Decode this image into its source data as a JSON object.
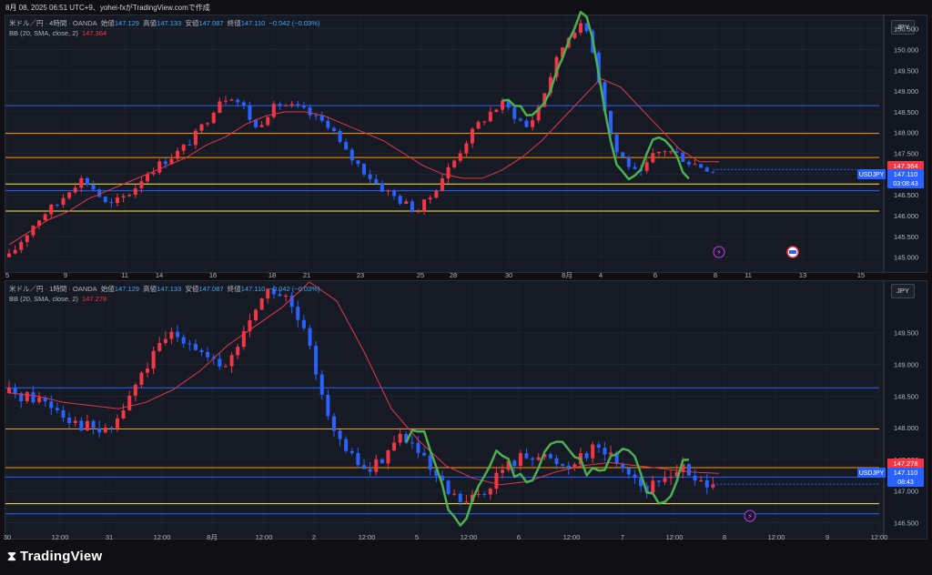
{
  "header": {
    "timestamp_line": "8月 08, 2025 06:51 UTC+9、yohei-fxがTradingView.comで作成"
  },
  "colors": {
    "up": "#f23645",
    "down": "#2962ff",
    "bb": "#e0384a",
    "green_curve": "#4caf50",
    "orange_line": "#ff9800",
    "yellow_line": "#ffeb3b",
    "blue_line": "#2962ff"
  },
  "branding": {
    "logo_text": "TradingView",
    "logo_icon": "tradingview-logo-icon"
  },
  "panels": [
    {
      "legend": {
        "symbol": "米ドル／円 · 4時間 · OANDA",
        "o_label": "始値",
        "o": "147.129",
        "h_label": "高値",
        "h": "147.133",
        "l_label": "安値",
        "l": "147.087",
        "c_label": "終値",
        "c": "147.110",
        "chg": "−0.042 (−0.03%)",
        "bb_label": "BB (20, SMA, close, 2)",
        "bb_value": "147.364"
      },
      "currency": "JPY",
      "price_tag": {
        "symbol": "USDJPY",
        "price": "147.110",
        "countdown": "03:08:43",
        "bb_tag": "147.364"
      },
      "chart_data": {
        "type": "candlestick",
        "timeframe": "4時間",
        "ylim": [
          144.75,
          150.8
        ],
        "y_ticks": [
          "150.500",
          "150.000",
          "149.500",
          "149.000",
          "148.500",
          "148.000",
          "147.500",
          "147.000",
          "146.500",
          "146.000",
          "145.500",
          "145.000"
        ],
        "x_ticks": [
          "5",
          "9",
          "11",
          "14",
          "16",
          "18",
          "21",
          "23",
          "25",
          "28",
          "30",
          "8月",
          "4",
          "6",
          "8",
          "11",
          "13",
          "15"
        ],
        "close_path": [
          145.0,
          145.4,
          145.8,
          146.1,
          146.3,
          146.7,
          146.9,
          146.6,
          146.2,
          146.4,
          146.6,
          147.0,
          147.2,
          147.4,
          147.6,
          147.9,
          148.3,
          148.8,
          148.9,
          148.6,
          148.1,
          148.5,
          148.7,
          148.6,
          148.5,
          148.3,
          148.2,
          147.6,
          147.3,
          147.0,
          146.7,
          146.5,
          146.3,
          146.1,
          146.4,
          146.9,
          147.3,
          147.8,
          148.2,
          148.5,
          148.7,
          148.4,
          148.1,
          148.7,
          149.5,
          150.2,
          150.6,
          150.4,
          148.9,
          147.6,
          147.3,
          146.9,
          147.4,
          147.6,
          147.5,
          147.3,
          147.2,
          147.1
        ],
        "bb_midline": [
          145.3,
          145.6,
          145.9,
          146.1,
          146.4,
          146.6,
          146.8,
          147.0,
          147.2,
          147.4,
          147.7,
          147.9,
          148.2,
          148.4,
          148.5,
          148.5,
          148.4,
          148.2,
          148.0,
          147.8,
          147.5,
          147.2,
          147.0,
          146.9,
          146.9,
          147.1,
          147.4,
          147.8,
          148.3,
          148.8,
          149.3,
          149.1,
          148.6,
          148.1,
          147.6,
          147.3,
          147.3
        ],
        "horizontal_lines": [
          {
            "price": 148.65,
            "color": "blue"
          },
          {
            "price": 147.98,
            "color": "orange"
          },
          {
            "price": 147.4,
            "color": "orange"
          },
          {
            "price": 146.76,
            "color": "yellow"
          },
          {
            "price": 146.6,
            "color": "blue"
          },
          {
            "price": 146.11,
            "color": "yellow"
          }
        ],
        "marker_icons": [
          "lightning-event-icon",
          "us-flag-event-icon"
        ]
      }
    },
    {
      "legend": {
        "symbol": "米ドル／円 · 1時間 · OANDA",
        "o_label": "始値",
        "o": "147.129",
        "h_label": "高値",
        "h": "147.133",
        "l_label": "安値",
        "l": "147.087",
        "c_label": "終値",
        "c": "147.110",
        "chg": "−0.042 (−0.03%)",
        "bb_label": "BB (20, SMA, close, 2)",
        "bb_value": "147.278"
      },
      "currency": "JPY",
      "price_tag": {
        "symbol": "USDJPY",
        "price": "147.110",
        "countdown": "08:43",
        "bb_tag": "147.278"
      },
      "chart_data": {
        "type": "candlestick",
        "timeframe": "1時間",
        "ylim": [
          146.35,
          150.3
        ],
        "y_ticks": [
          "149.500",
          "149.000",
          "148.500",
          "148.000",
          "147.500",
          "147.000",
          "146.500"
        ],
        "x_ticks": [
          "30",
          "12:00",
          "31",
          "12:00",
          "8月",
          "12:00",
          "2",
          "12:00",
          "5",
          "12:00",
          "6",
          "12:00",
          "7",
          "12:00",
          "8",
          "12:00",
          "9",
          "12:00"
        ],
        "close_path": [
          148.55,
          148.5,
          148.45,
          148.3,
          148.1,
          148.0,
          147.9,
          148.3,
          148.8,
          149.2,
          149.5,
          149.4,
          149.1,
          148.9,
          149.3,
          149.9,
          150.2,
          150.0,
          149.5,
          148.7,
          147.8,
          147.5,
          147.3,
          147.6,
          147.9,
          147.6,
          147.2,
          146.9,
          146.8,
          147.0,
          147.3,
          147.5,
          147.6,
          147.5,
          147.4,
          147.6,
          147.7,
          147.5,
          147.3,
          147.0,
          147.2,
          147.4,
          147.1,
          147.2
        ],
        "bb_midline": [
          148.55,
          148.5,
          148.4,
          148.35,
          148.3,
          148.4,
          148.6,
          148.9,
          149.3,
          149.6,
          149.9,
          150.3,
          150.0,
          149.2,
          148.3,
          147.8,
          147.4,
          147.2,
          147.1,
          147.15,
          147.3,
          147.4,
          147.45,
          147.4,
          147.35,
          147.3,
          147.28
        ],
        "horizontal_lines": [
          {
            "price": 148.63,
            "color": "blue"
          },
          {
            "price": 147.98,
            "color": "orange"
          },
          {
            "price": 147.37,
            "color": "orange"
          },
          {
            "price": 147.22,
            "color": "blue"
          },
          {
            "price": 146.8,
            "color": "yellow"
          },
          {
            "price": 146.64,
            "color": "blue"
          }
        ],
        "marker_icons": [
          "lightning-event-icon"
        ]
      }
    }
  ]
}
